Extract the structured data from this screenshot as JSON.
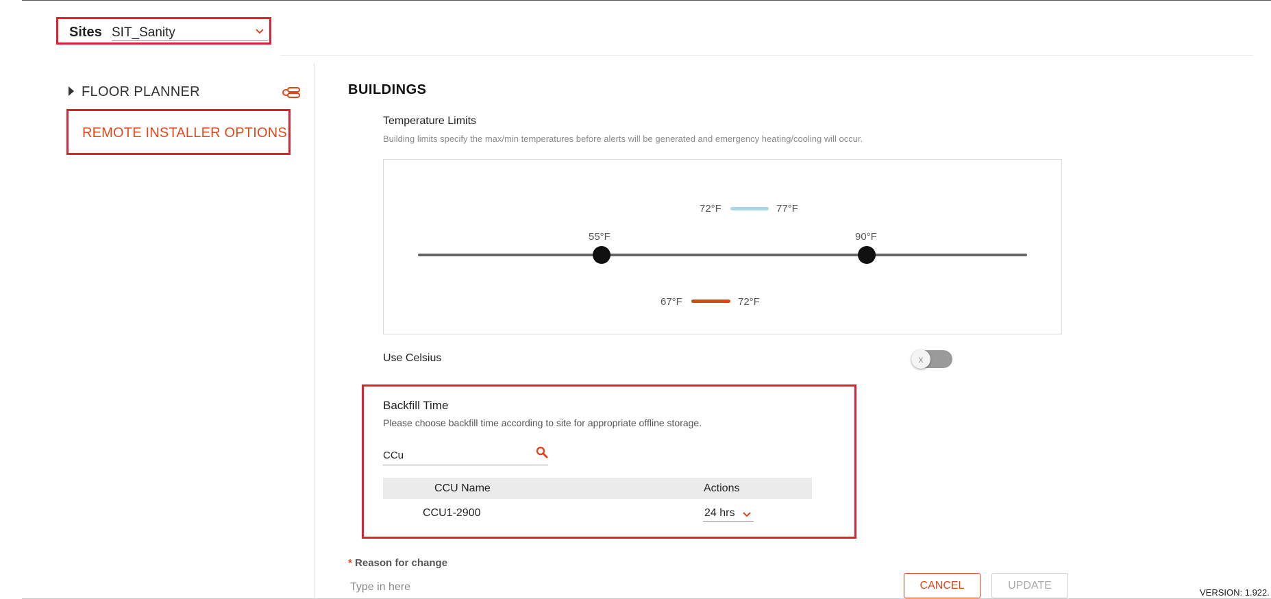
{
  "header": {
    "sites_label": "Sites",
    "sites_value": "SIT_Sanity"
  },
  "sidebar": {
    "floor_planner_label": "FLOOR PLANNER",
    "remote_installer_label": "REMOTE INSTALLER OPTIONS"
  },
  "buildings": {
    "title": "BUILDINGS",
    "temperature_limits": {
      "title": "Temperature Limits",
      "description": "Building limits specify the max/min temperatures before alerts will be generated and emergency heating/cooling will occur.",
      "cooling_min": "72°F",
      "cooling_max": "77°F",
      "heating_min": "67°F",
      "heating_max": "72°F",
      "building_limit_min": "55°F",
      "building_limit_max": "90°F"
    },
    "use_celsius_label": "Use Celsius",
    "use_celsius_enabled": false,
    "toggle_off_glyph": "x"
  },
  "backfill": {
    "title": "Backfill Time",
    "description": "Please choose backfill time according to site for appropriate offline storage.",
    "search_value": "CCu",
    "columns": [
      "CCU Name",
      "Actions"
    ],
    "rows": [
      {
        "ccu_name": "CCU1-2900",
        "backfill_time": "24 hrs"
      }
    ]
  },
  "reason": {
    "label": "Reason for change",
    "required_marker": "*",
    "placeholder": "Type in here"
  },
  "buttons": {
    "cancel": "CANCEL",
    "update": "UPDATE"
  },
  "version_text": "VERSION: 1.922.",
  "colors": {
    "accent": "#e0451a",
    "highlight_border": "#e02030",
    "cooling_bar": "#a8d8e6",
    "heating_bar": "#e0451a"
  }
}
